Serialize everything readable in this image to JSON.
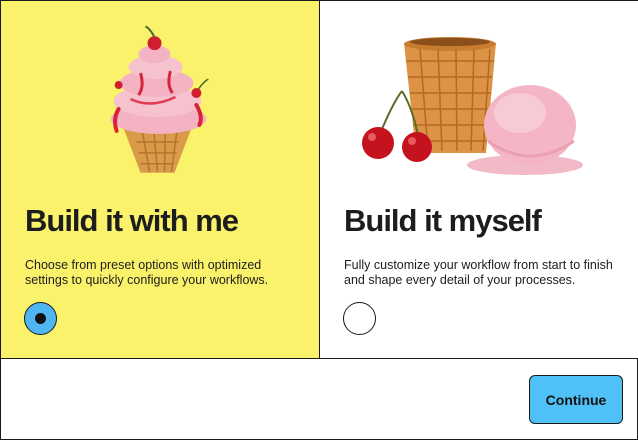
{
  "options": [
    {
      "title": "Build it with me",
      "description": "Choose from preset options with optimized settings to quickly configure your workflows.",
      "selected": true,
      "illustration": "ice-cream-cone-swirl"
    },
    {
      "title": "Build it myself",
      "description": "Fully customize your workflow from start to finish and shape every detail of your processes.",
      "selected": false,
      "illustration": "empty-cone-cherries-scoop"
    }
  ],
  "footer": {
    "continue_label": "Continue"
  },
  "colors": {
    "selected_card_bg": "#fbf26c",
    "radio_selected": "#4fb6f2",
    "continue_button": "#4fc1f7"
  }
}
